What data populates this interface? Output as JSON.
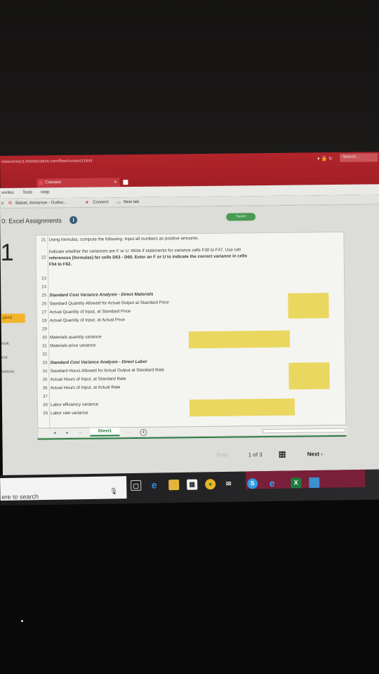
{
  "browser": {
    "address": "newconnect.mheducation.com/flow/connect.html",
    "search_placeholder": "Search...",
    "tab_title": "Connect",
    "tab_close": "×",
    "menu": [
      "vorites",
      "Tools",
      "Help"
    ],
    "favorites": [
      "s",
      "Balser, Annarose - Outloo...",
      "Connect",
      "New tab"
    ]
  },
  "page": {
    "title": "0: Excel Assignments",
    "saved_label": "Saved",
    "question_number": "1",
    "side_labels": [
      "pped",
      "look",
      "rint",
      "rences"
    ]
  },
  "sheet": {
    "rows": [
      {
        "num": "21",
        "text": "Using formulas, compute the following.  Input all numbers as positive amounts."
      },
      {
        "num": "22",
        "text": "Indicate whether the variances are F or U. Write if statements for variance cells F30 to F47. Use cell",
        "text2": "references (formulas) for cells D53 - D60. Enter an  F or U to indicate the correct variance in cells",
        "text3": "F54 to F62."
      },
      {
        "num": "23",
        "text": ""
      },
      {
        "num": "24",
        "text": ""
      },
      {
        "num": "25",
        "text": "Standard Cost Variance Analysis - Direct Materials",
        "bold": true
      },
      {
        "num": "26",
        "text": "Standard Quantity Allowed for Actual Output at Standard Price"
      },
      {
        "num": "27",
        "text": "Actual Quantity of Input, at Standard Price"
      },
      {
        "num": "28",
        "text": "Actual Quantity of Input, at Actual Price"
      },
      {
        "num": "29",
        "text": ""
      },
      {
        "num": "30",
        "text": "   Materials quantity variance"
      },
      {
        "num": "31",
        "text": "   Materials price variance"
      },
      {
        "num": "32",
        "text": ""
      },
      {
        "num": "33",
        "text": "Standard Cost Variance Analysis - Direct Labor",
        "bold": true
      },
      {
        "num": "34",
        "text": "Standard Hours Allowed for Actual Output at Standard Rate"
      },
      {
        "num": "35",
        "text": "Actual Hours of Input, at Standard Rate"
      },
      {
        "num": "36",
        "text": "Actual Hours of Input, at Actual Rate"
      },
      {
        "num": "37",
        "text": ""
      },
      {
        "num": "38",
        "text": "   Labor efficiency variance"
      },
      {
        "num": "39",
        "text": "   Labor rate variance"
      }
    ],
    "sheet_tab": "Sheet1",
    "nav_prev": "◂",
    "nav_next": "▸",
    "ellipsis": "...",
    "add": "+"
  },
  "pager": {
    "prev": "Prev",
    "current": "1",
    "of": "of",
    "total": "3",
    "next": "Next"
  },
  "taskbar": {
    "search_text": "ere to search",
    "icons": [
      "microphone-icon",
      "task-view-icon",
      "edge-icon",
      "file-explorer-icon",
      "store-icon",
      "chrome-icon",
      "mail-icon",
      "skype-icon",
      "ie-icon",
      "excel-icon",
      "photos-icon"
    ]
  },
  "colors": {
    "chrome_red": "#b2242b",
    "highlight_yellow": "#e9d75f",
    "excel_green": "#2a7f45"
  }
}
